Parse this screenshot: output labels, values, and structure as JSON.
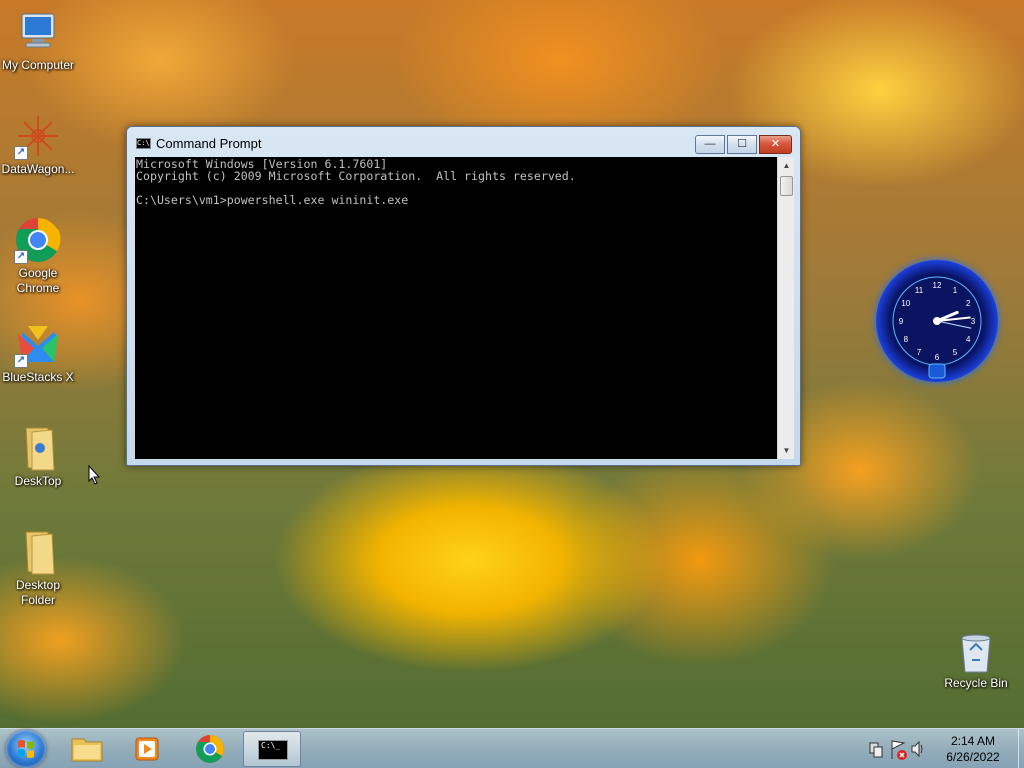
{
  "desktop": {
    "icons": [
      {
        "label": "My Computer",
        "icon": "computer-icon"
      },
      {
        "label": "DataWagon...",
        "icon": "datawagon-icon"
      },
      {
        "label": "Google Chrome",
        "icon": "chrome-icon"
      },
      {
        "label": "BlueStacks X",
        "icon": "bluestacks-icon"
      },
      {
        "label": "DeskTop",
        "icon": "folder-icon"
      },
      {
        "label": "Desktop Folder",
        "icon": "folder-icon"
      }
    ],
    "recycle_bin": {
      "label": "Recycle Bin",
      "icon": "recycle-bin-icon"
    }
  },
  "window": {
    "title": "Command Prompt",
    "title_icon_text": "C:\\",
    "buttons": {
      "minimize": "—",
      "maximize": "☐",
      "close": "✕"
    },
    "console_text": "Microsoft Windows [Version 6.1.7601]\nCopyright (c) 2009 Microsoft Corporation.  All rights reserved.\n\nC:\\Users\\vm1>powershell.exe wininit.exe"
  },
  "clock_gadget": {
    "numbers": [
      "12",
      "1",
      "2",
      "3",
      "4",
      "5",
      "6",
      "7",
      "8",
      "9",
      "10",
      "11"
    ],
    "hour": 2,
    "minute": 14,
    "second": 17
  },
  "taskbar": {
    "pinned": [
      {
        "name": "windows-explorer",
        "icon": "folder-icon"
      },
      {
        "name": "media-player",
        "icon": "media-player-icon"
      },
      {
        "name": "google-chrome",
        "icon": "chrome-icon"
      },
      {
        "name": "command-prompt",
        "icon": "cmd-icon",
        "active": true
      }
    ],
    "cmd_icon_text": "C:\\_",
    "time": "2:14 AM",
    "date": "6/26/2022"
  }
}
